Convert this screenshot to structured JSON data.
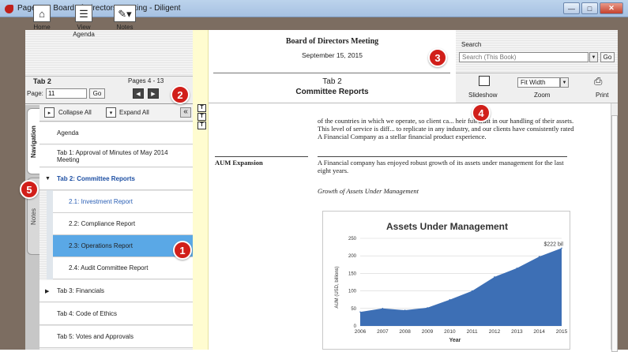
{
  "window": {
    "title": "Page 11 - Board of Directors Meeting - Diligent"
  },
  "toolbar": {
    "home_label": "Home",
    "view_agenda_label": "View\nAgenda",
    "notes_label": "Notes"
  },
  "tab_header": {
    "tab_label": "Tab 2",
    "pages": "Pages 4 - 13",
    "page_label": "Page:",
    "page_value": "11",
    "go_label": "Go"
  },
  "nav_header": {
    "collapse_all": "Collapse All",
    "expand_all": "Expand All"
  },
  "side_tabs": {
    "navigation": "Navigation",
    "notes": "Notes"
  },
  "nav_items": [
    {
      "label": "Agenda"
    },
    {
      "label": "Tab 1: Approval of Minutes of May 2014 Meeting"
    },
    {
      "label": "Tab 2: Committee Reports"
    },
    {
      "label": "2.1: Investment Report"
    },
    {
      "label": "2.2: Compliance Report"
    },
    {
      "label": "2.3: Operations Report"
    },
    {
      "label": "2.4: Audit Committee Report"
    },
    {
      "label": "Tab 3: Financials"
    },
    {
      "label": "Tab 4: Code of Ethics"
    },
    {
      "label": "Tab 5: Votes and Approvals"
    }
  ],
  "document": {
    "title": "Board of Directors Meeting",
    "date": "September 15, 2015",
    "tab_title": "Tab 2",
    "tab_subtitle": "Committee Reports",
    "para1": "of the countries in which we operate, so client ca... heir full trust in our handling of their assets. This level of service is diff... to replicate in any industry, and our clients have consistently rated A Financial Company as a stellar financial product experience.",
    "section_heading": "AUM Expansion",
    "para2": "A Financial company has enjoyed robust growth of its assets under management for the last eight years.",
    "caption": "Growth of Assets Under Management"
  },
  "search": {
    "label": "Search",
    "placeholder": "Search (This Book)",
    "go_label": "Go"
  },
  "view_controls": {
    "slideshow_label": "Slideshow",
    "zoom_value": "Fit Width",
    "zoom_label": "Zoom",
    "print_label": "Print"
  },
  "callouts": [
    "1",
    "2",
    "3",
    "4",
    "5"
  ],
  "chart_data": {
    "type": "area",
    "title": "Assets Under Management",
    "xlabel": "Year",
    "ylabel": "AUM (USD, billions)",
    "x": [
      "2006",
      "2007",
      "2008",
      "2009",
      "2010",
      "2011",
      "2012",
      "2013",
      "2014",
      "2015"
    ],
    "values": [
      40,
      50,
      45,
      52,
      75,
      100,
      140,
      165,
      198,
      222
    ],
    "ylim": [
      0,
      250
    ],
    "yticks": [
      0,
      50,
      100,
      150,
      200,
      250
    ],
    "end_label": "$222 bil",
    "color": "#3d6fb5"
  }
}
